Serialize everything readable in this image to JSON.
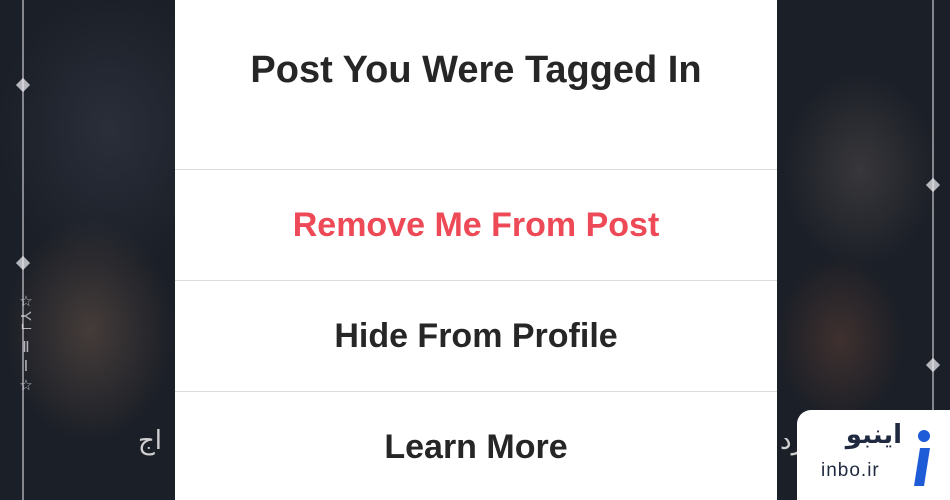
{
  "dialog": {
    "title": "Post You Were Tagged In",
    "options": [
      {
        "label": "Remove Me From Post",
        "color": "#ed4956"
      },
      {
        "label": "Hide From Profile",
        "color": "#262626"
      },
      {
        "label": "Learn More",
        "color": "#262626"
      }
    ]
  },
  "background": {
    "side_text": "☆YᄂⅡⅠ☆",
    "behind_text_left": "اج",
    "behind_text_right": "رد"
  },
  "watermark": {
    "brand_fa": "اینبو",
    "domain": "inbo.ir",
    "logo_icon": "info-i-logo",
    "logo_color": "#1e5bd6"
  }
}
